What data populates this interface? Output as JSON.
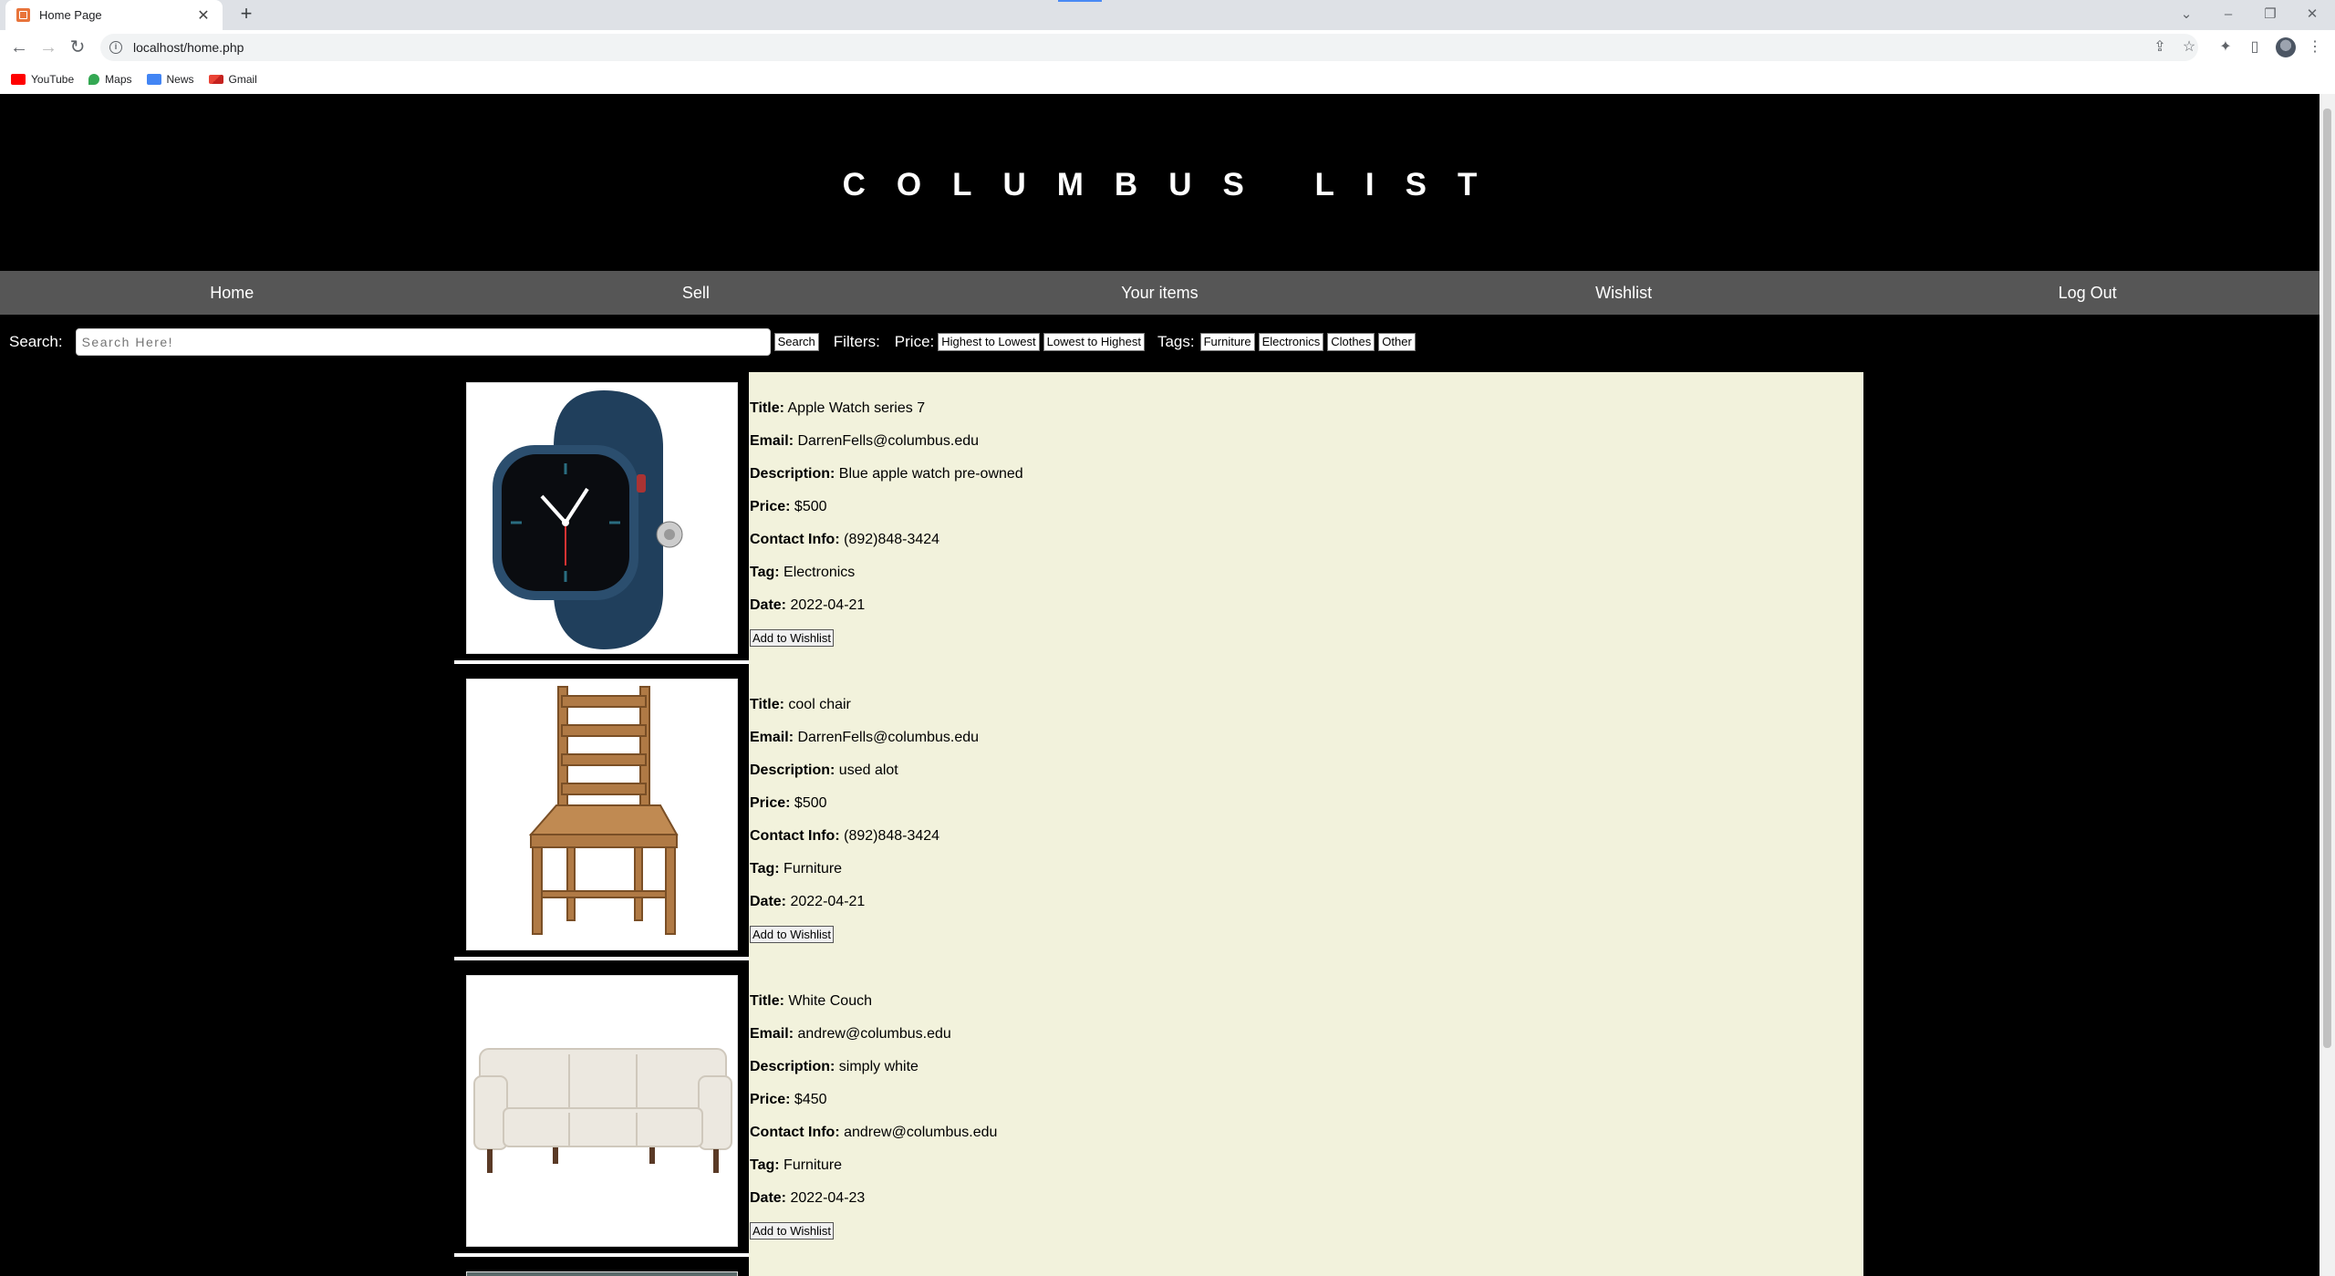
{
  "browser": {
    "tab_title": "Home Page",
    "url": "localhost/home.php",
    "bookmarks": [
      {
        "label": "YouTube",
        "icon": "youtube-icon",
        "color": "#ff0000"
      },
      {
        "label": "Maps",
        "icon": "maps-icon",
        "color": "#34a853"
      },
      {
        "label": "News",
        "icon": "news-icon",
        "color": "#4285f4"
      },
      {
        "label": "Gmail",
        "icon": "gmail-icon",
        "color": "#ea4335"
      }
    ]
  },
  "site": {
    "title": "COLUMBUS LIST",
    "nav": [
      "Home",
      "Sell",
      "Your items",
      "Wishlist",
      "Log Out"
    ]
  },
  "search": {
    "label": "Search:",
    "placeholder": "Search Here!",
    "button": "Search",
    "filters_label": "Filters:",
    "price_label": "Price:",
    "price_options": [
      "Highest to Lowest",
      "Lowest to Highest"
    ],
    "tags_label": "Tags:",
    "tag_options": [
      "Furniture",
      "Electronics",
      "Clothes",
      "Other"
    ]
  },
  "field_labels": {
    "title": "Title:",
    "email": "Email:",
    "description": "Description:",
    "price": "Price:",
    "contact": "Contact Info:",
    "tag": "Tag:",
    "date": "Date:"
  },
  "wishlist_button": "Add to Wishlist",
  "listings": [
    {
      "image": "smartwatch",
      "title": "Apple Watch series 7",
      "email": "DarrenFells@columbus.edu",
      "description": "Blue apple watch pre-owned",
      "price": "$500",
      "contact": "(892)848-3424",
      "tag": "Electronics",
      "date": "2022-04-21"
    },
    {
      "image": "wooden-chair",
      "title": "cool chair",
      "email": "DarrenFells@columbus.edu",
      "description": "used alot",
      "price": "$500",
      "contact": "(892)848-3424",
      "tag": "Furniture",
      "date": "2022-04-21"
    },
    {
      "image": "white-couch",
      "title": "White Couch",
      "email": "andrew@columbus.edu",
      "description": "simply white",
      "price": "$450",
      "contact": "andrew@columbus.edu",
      "tag": "Furniture",
      "date": "2022-04-23"
    }
  ]
}
